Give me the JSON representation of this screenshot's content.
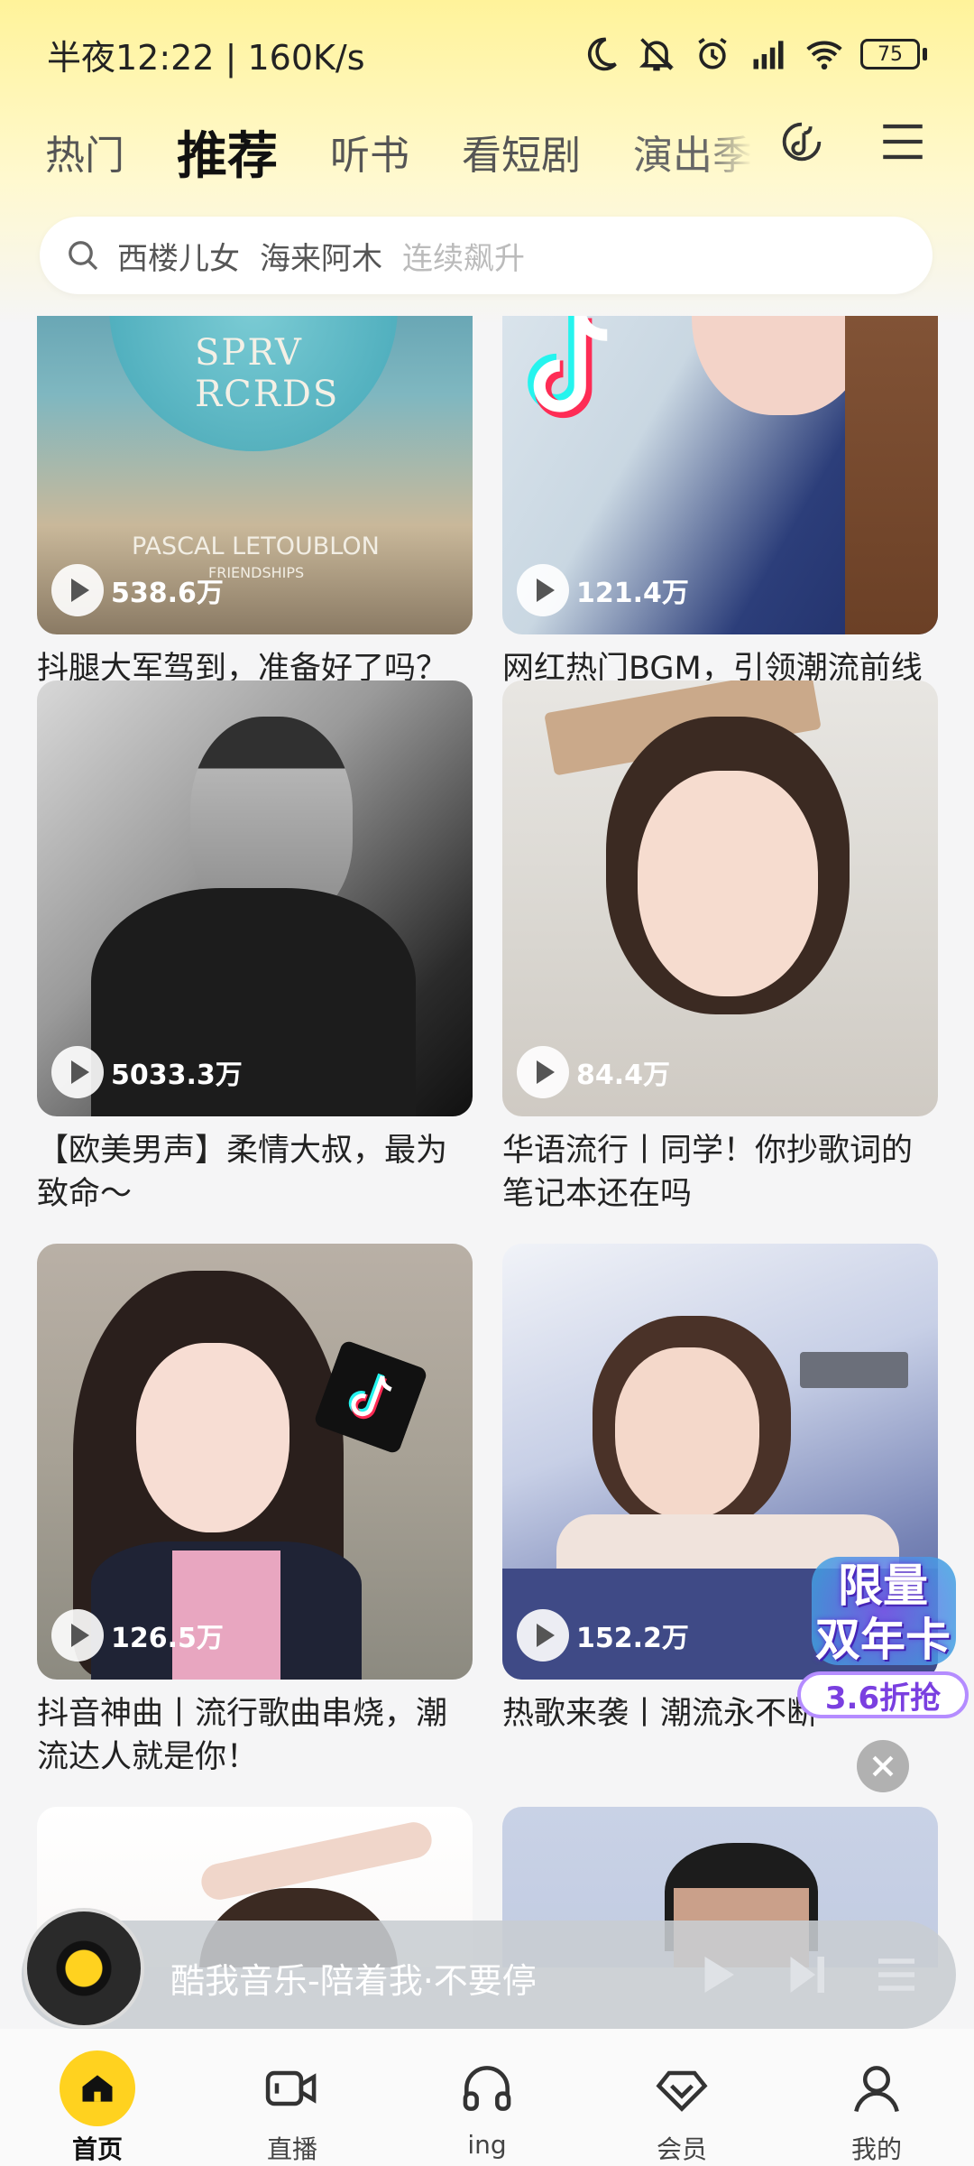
{
  "status_bar": {
    "time_speed": "半夜12:22 | 160K/s",
    "battery": "75",
    "icons": [
      "moon-icon",
      "bell-muted-icon",
      "alarm-icon",
      "signal-icon",
      "wifi-icon",
      "battery-icon"
    ]
  },
  "tabs": [
    {
      "label": "热门"
    },
    {
      "label": "推荐"
    },
    {
      "label": "听书"
    },
    {
      "label": "看短剧"
    },
    {
      "label": "演出季"
    }
  ],
  "active_tab": "推荐",
  "search": {
    "query_1": "西楼儿女",
    "query_2": "海来阿木",
    "hint": "连续飙升"
  },
  "cards": [
    {
      "plays": "538.6万",
      "title": "抖腿大军驾到，准备好了吗？",
      "cover_text_1": "SPRV",
      "cover_text_2": "RCRDS",
      "cover_text_3": "PASCAL LETOUBLON",
      "cover_text_4": "FRIENDSHIPS"
    },
    {
      "plays": "121.4万",
      "title": "网红热门BGM，引领潮流前线"
    },
    {
      "plays": "5033.3万",
      "title": "【欧美男声】柔情大叔，最为致命～"
    },
    {
      "plays": "84.4万",
      "title": "华语流行丨同学！你抄歌词的笔记本还在吗"
    },
    {
      "plays": "126.5万",
      "title": "抖音神曲丨流行歌曲串烧，潮流达人就是你！"
    },
    {
      "plays": "152.2万",
      "title": "热歌来袭丨潮流永不断"
    }
  ],
  "promo": {
    "line1": "限量",
    "line2": "双年卡",
    "button": "3.6折抢"
  },
  "player": {
    "title": "酷我音乐-陪着我·不要停"
  },
  "bottom_nav": [
    {
      "label": "首页"
    },
    {
      "label": "直播"
    },
    {
      "label": "ing"
    },
    {
      "label": "会员"
    },
    {
      "label": "我的"
    }
  ],
  "colors": {
    "accent": "#ffd21f",
    "promo_purple": "#7a3fe0"
  }
}
